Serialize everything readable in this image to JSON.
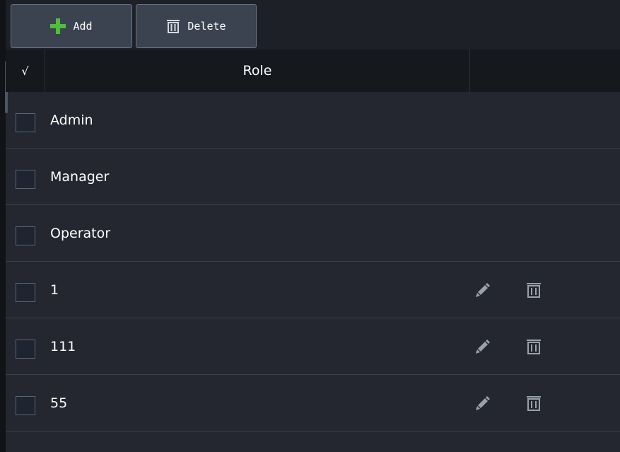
{
  "toolbar": {
    "add_label": "Add",
    "delete_label": "Delete"
  },
  "table": {
    "check_header": "√",
    "role_header": "Role",
    "rows": [
      {
        "name": "Admin",
        "checked": false,
        "has_actions": false
      },
      {
        "name": "Manager",
        "checked": false,
        "has_actions": false
      },
      {
        "name": "Operator",
        "checked": false,
        "has_actions": false
      },
      {
        "name": "1",
        "checked": false,
        "has_actions": true
      },
      {
        "name": "111",
        "checked": false,
        "has_actions": true
      },
      {
        "name": "55",
        "checked": false,
        "has_actions": true
      }
    ]
  },
  "icons": {
    "add": "plus-icon",
    "delete": "trash-icon",
    "edit": "pencil-icon",
    "row_delete": "trash-icon"
  },
  "colors": {
    "background": "#24272f",
    "header_background": "#15181d",
    "button_background": "#3c4350",
    "plus_green": "#4fbf3a",
    "icon_gray": "#9aa1ab"
  }
}
